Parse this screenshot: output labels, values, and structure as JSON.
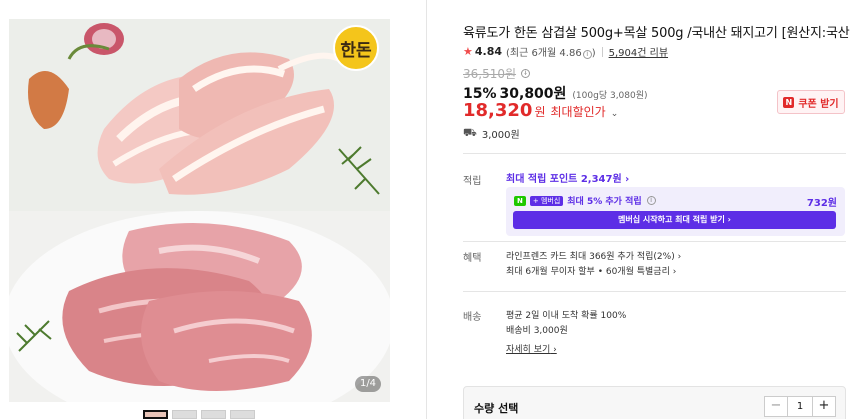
{
  "gallery": {
    "logo_text": "한돈",
    "counter": "1/4",
    "thumb_count": 4
  },
  "product": {
    "title": "육류도가 한돈 삼겹살 500g+목살 500g /국내산 돼지고기 [원산지:국산]",
    "rating": "4.84",
    "recent_rating": "(최근 6개월 4.86",
    "recent_rating_close": ")",
    "review_count": "5,904건 리뷰",
    "original_price": "36,510원",
    "discount": "15%",
    "sale_price": "30,800원",
    "unit_price": "(100g당 3,080원)",
    "max_discount_price": "18,320",
    "max_discount_won": "원",
    "max_discount_label": "최대할인가",
    "coupon_button": "쿠폰 받기",
    "coupon_icon_letter": "N",
    "shipping_fee": "3,000원"
  },
  "points": {
    "label": "적립",
    "max_points": "최대 적립 포인트 2,347원",
    "np_badge_n": "N",
    "np_badge_plus": "+ 멤버십",
    "np_text": "최대 5% 추가 적립",
    "np_amount": "732원",
    "np_button": "멤버십 시작하고 최대 적립 받기"
  },
  "benefits": {
    "label": "혜택",
    "line1": "라인프렌즈 카드 최대 366원 추가 적립(2%)",
    "line2": "최대 6개월 무이자 할부 • 60개월 특별금리"
  },
  "delivery": {
    "label": "배송",
    "line1": "평균 2일 이내 도착 확률 100%",
    "line2": "배송비 3,000원",
    "detail_link": "자세히 보기"
  },
  "quantity": {
    "label": "수량 선택",
    "value": "1",
    "minus": "−",
    "plus": "+"
  },
  "colors": {
    "accent_red": "#e12a2a",
    "accent_purple": "#5d2ee6",
    "naver_green": "#1ec800"
  }
}
